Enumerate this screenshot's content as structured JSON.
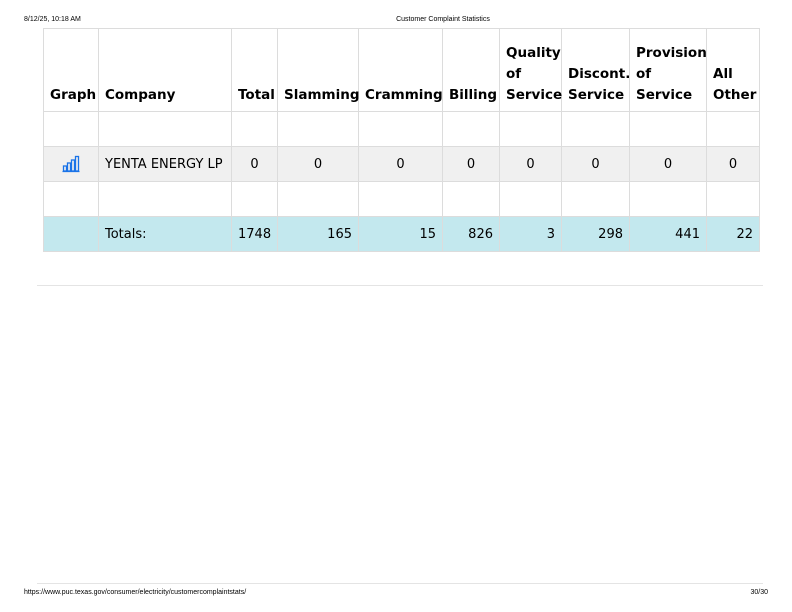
{
  "print_header": {
    "date": "8/12/25, 10:18 AM",
    "title": "Customer Complaint Statistics"
  },
  "table": {
    "headers": [
      "Graph",
      "Company",
      "Total",
      "Slamming",
      "Cramming",
      "Billing",
      "Quality of Service",
      "Discont. Service",
      "Provision of Service",
      "All Other"
    ],
    "rows": [
      {
        "company": "YENTA ENERGY LP",
        "total": "0",
        "slamming": "0",
        "cramming": "0",
        "billing": "0",
        "quality": "0",
        "discont": "0",
        "provision": "0",
        "other": "0"
      }
    ],
    "totals": {
      "label": "Totals:",
      "total": "1748",
      "slamming": "165",
      "cramming": "15",
      "billing": "826",
      "quality": "3",
      "discont": "298",
      "provision": "441",
      "other": "22"
    }
  },
  "icons": {
    "graph": "bar-chart-icon",
    "graph_color": "#1a73e8"
  },
  "print_footer": {
    "url": "https://www.puc.texas.gov/consumer/electricity/customercomplaintstats/",
    "page": "30/30"
  }
}
